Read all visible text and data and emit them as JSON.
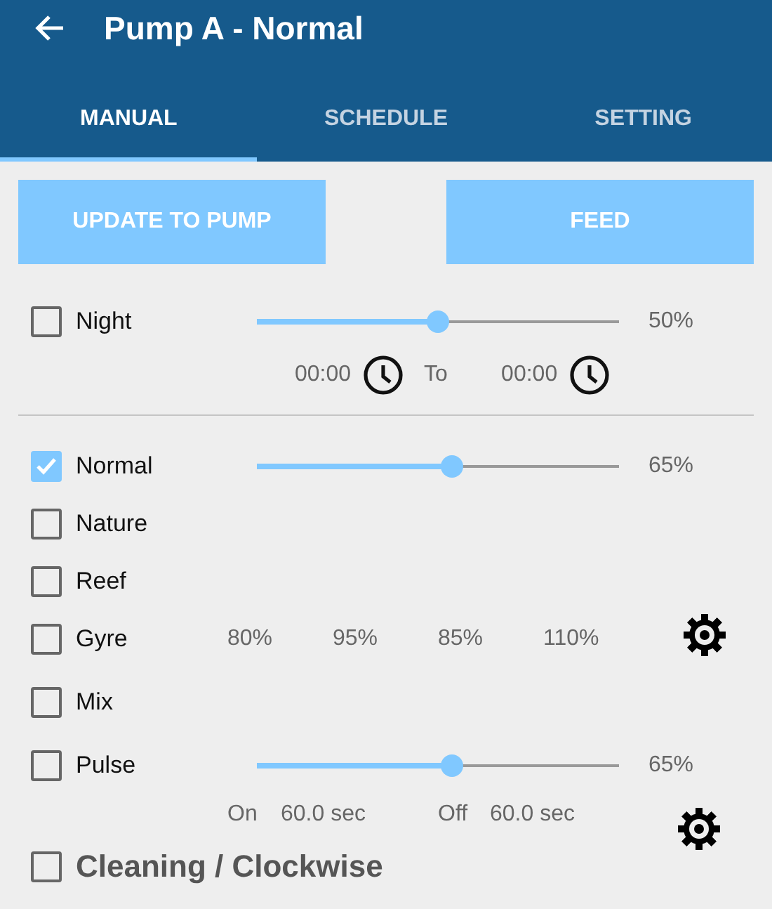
{
  "header": {
    "title": "Pump A - Normal"
  },
  "tabs": [
    {
      "label": "MANUAL",
      "selected": true
    },
    {
      "label": "SCHEDULE",
      "selected": false
    },
    {
      "label": "SETTING",
      "selected": false
    }
  ],
  "buttons": [
    "UPDATE TO PUMP",
    "FEED"
  ],
  "night": {
    "label": "Night",
    "checked": false,
    "level": 0.5,
    "reading": "50%",
    "from": "00:00",
    "to_label": "To",
    "to": "00:00"
  },
  "modes": [
    {
      "kind": "slider",
      "label": "Normal",
      "checked": true,
      "level": 0.54,
      "reading": "65%"
    },
    {
      "kind": "plain",
      "label": "Nature",
      "checked": false
    },
    {
      "kind": "plain",
      "label": "Reef",
      "checked": false
    },
    {
      "kind": "gyre",
      "label": "Gyre",
      "checked": false,
      "values": [
        "80%",
        "95%",
        "85%",
        "110%"
      ]
    },
    {
      "kind": "plain",
      "label": "Mix",
      "checked": false
    },
    {
      "kind": "pulse",
      "label": "Pulse",
      "checked": false,
      "level": 0.54,
      "reading": "65%",
      "on_label": "On",
      "on_value": "60.0 sec",
      "off_label": "Off",
      "off_value": "60.0 sec"
    }
  ],
  "cleaning": {
    "label": "Cleaning / Clockwise",
    "checked": false
  }
}
